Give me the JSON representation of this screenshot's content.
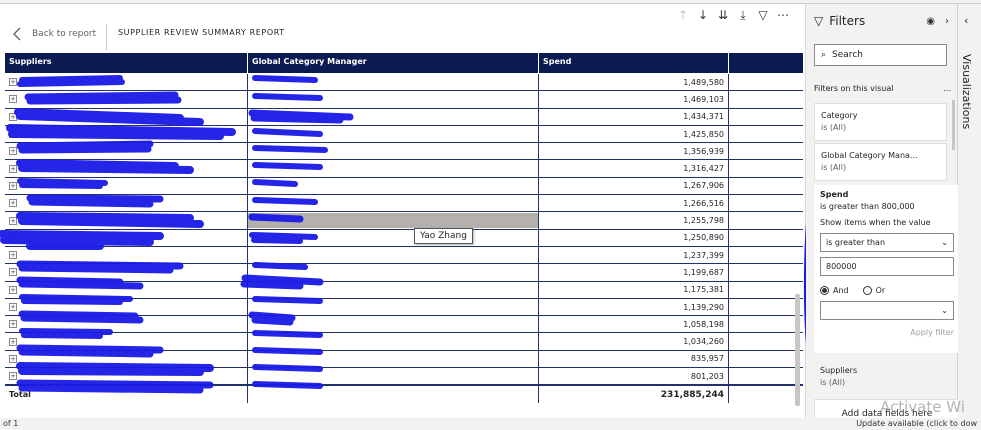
{
  "report": {
    "back_label": "Back to report",
    "title": "SUPPLIER REVIEW SUMMARY REPORT"
  },
  "table": {
    "headers": [
      "Suppliers",
      "Global Category Manager",
      "Spend"
    ],
    "rows": [
      {
        "spend": "1,489,580"
      },
      {
        "spend": "1,469,103"
      },
      {
        "spend": "1,434,371"
      },
      {
        "spend": "1,425,850"
      },
      {
        "spend": "1,356,939"
      },
      {
        "spend": "1,316,427"
      },
      {
        "spend": "1,267,906"
      },
      {
        "spend": "1,266,516"
      },
      {
        "spend": "1,255,798"
      },
      {
        "spend": "1,250,890"
      },
      {
        "spend": "1,237,399"
      },
      {
        "spend": "1,199,687"
      },
      {
        "spend": "1,175,381"
      },
      {
        "spend": "1,139,290"
      },
      {
        "spend": "1,058,198"
      },
      {
        "spend": "1,034,260"
      },
      {
        "spend": "835,957"
      },
      {
        "spend": "801,203"
      }
    ],
    "total_label": "Total",
    "total_value": "231,885,244"
  },
  "tooltip": "Yao Zhang",
  "filters": {
    "title": "Filters",
    "search_placeholder": "Search",
    "section": "Filters on this visual",
    "more": "...",
    "category": {
      "name": "Category",
      "state": "is (All)"
    },
    "gcm": {
      "name": "Global Category Mana...",
      "state": "is (All)"
    },
    "spend": {
      "name": "Spend",
      "state": "is greater than 800,000",
      "show_label": "Show items when the value",
      "condition": "is greater than",
      "value": "800000",
      "and": "And",
      "or": "Or",
      "apply": "Apply filter"
    },
    "suppliers": {
      "name": "Suppliers",
      "state": "is (All)"
    },
    "add_data": "Add data fields here"
  },
  "viz_label": "Visualizations",
  "status": {
    "page": "of 1",
    "update": "Update available (click to dow"
  },
  "watermark": "Activate Wi",
  "colors": {
    "header_bg": "#0c1a52",
    "highlight": "#b3b0ad",
    "scribble": "#1a1ae6"
  }
}
